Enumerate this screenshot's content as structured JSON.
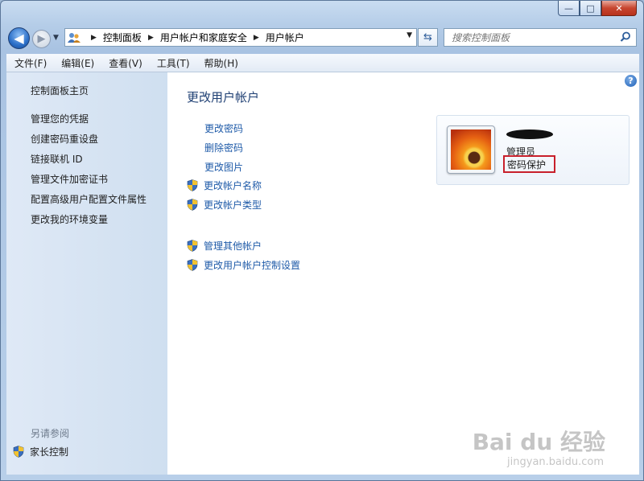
{
  "window": {
    "caption_buttons": {
      "minimize": "—",
      "maximize": "□",
      "close": "✕"
    }
  },
  "breadcrumb": [
    "控制面板",
    "用户帐户和家庭安全",
    "用户帐户"
  ],
  "search": {
    "placeholder": "搜索控制面板"
  },
  "menu": [
    "文件(F)",
    "编辑(E)",
    "查看(V)",
    "工具(T)",
    "帮助(H)"
  ],
  "sidebar": {
    "items": [
      "控制面板主页",
      "管理您的凭据",
      "创建密码重设盘",
      "链接联机 ID",
      "管理文件加密证书",
      "配置高级用户配置文件属性",
      "更改我的环境变量"
    ],
    "see_also_heading": "另请参阅",
    "see_also_items": [
      "家长控制"
    ]
  },
  "main": {
    "title": "更改用户帐户",
    "links": [
      "更改密码",
      "删除密码",
      "更改图片"
    ],
    "shield_links": [
      "更改帐户名称",
      "更改帐户类型"
    ],
    "other_links": [
      "管理其他帐户",
      "更改用户帐户控制设置"
    ]
  },
  "account": {
    "role": "管理员",
    "status": "密码保护"
  },
  "watermark": {
    "main": "Bai du 经验",
    "sub": "jingyan.baidu.com"
  },
  "colors": {
    "link": "#1e5aa8",
    "highlight_box": "#c8202b",
    "title": "#1e3f73"
  }
}
